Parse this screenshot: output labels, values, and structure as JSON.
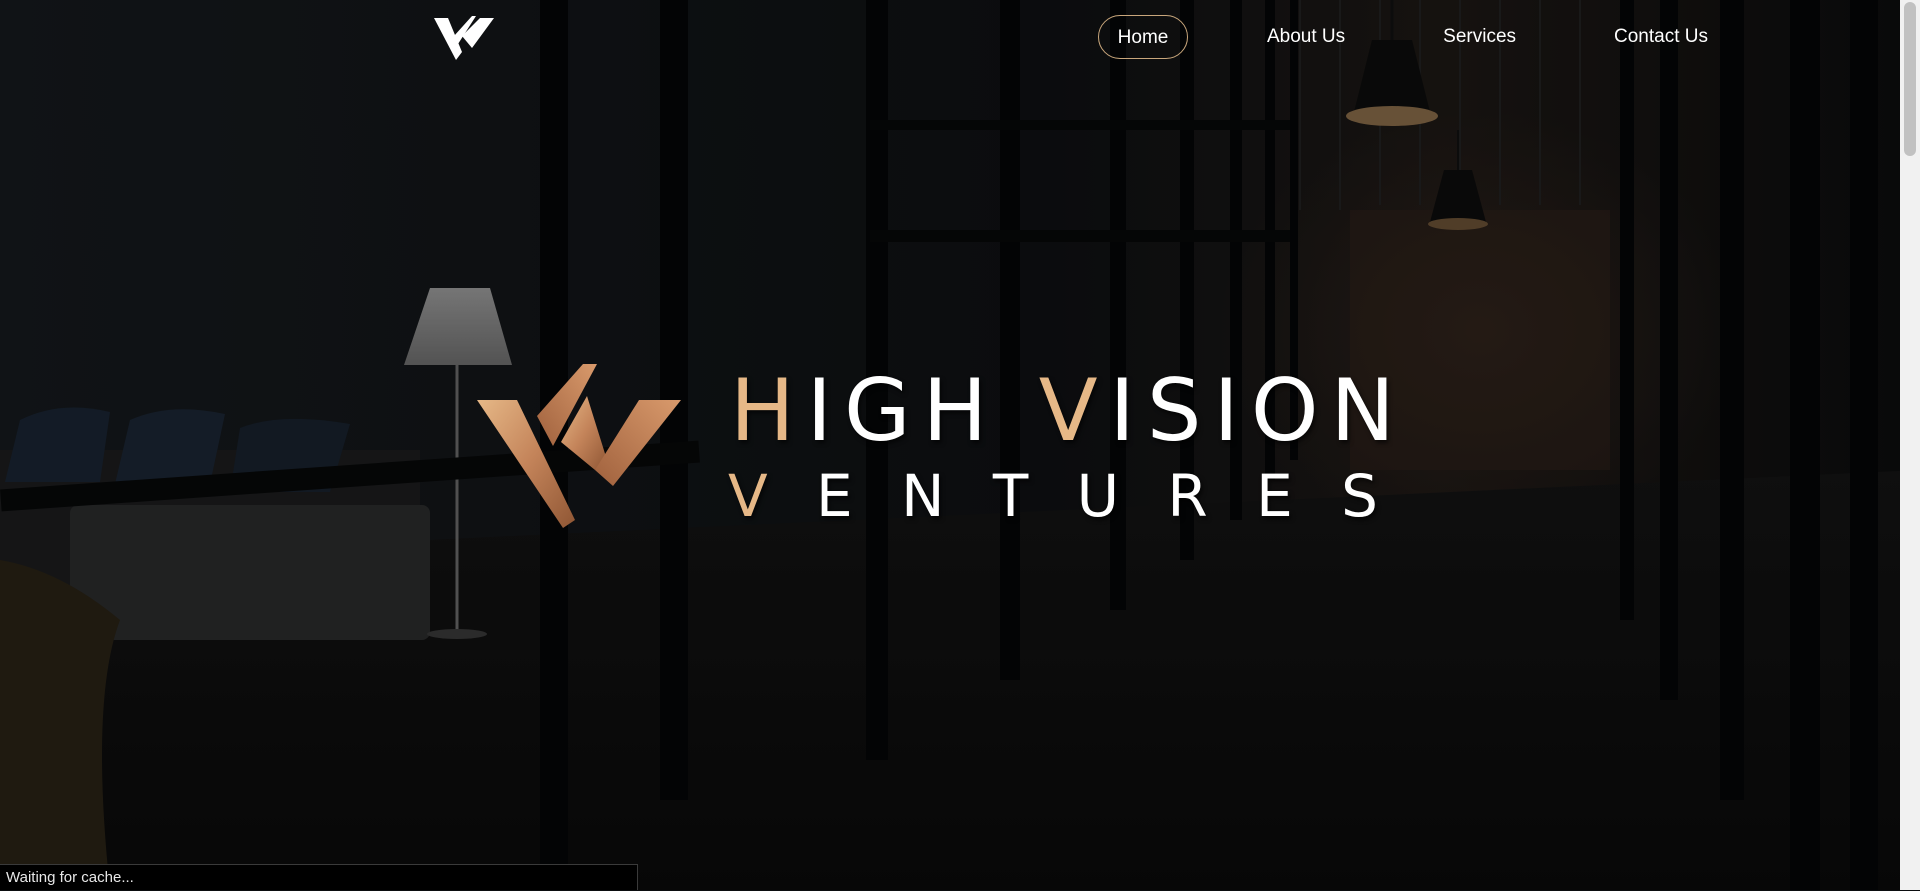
{
  "nav": {
    "items": [
      {
        "label": "Home",
        "active": true
      },
      {
        "label": "About Us"
      },
      {
        "label": "Services"
      },
      {
        "label": "Contact Us"
      }
    ]
  },
  "hero": {
    "title_first_initial": "H",
    "title_first_rest": "IGH ",
    "title_second_initial": "V",
    "title_second_rest": "ISION",
    "subtitle_letters": [
      "V",
      "E",
      "N",
      "T",
      "U",
      "R",
      "E",
      "S"
    ]
  },
  "status_bar": {
    "text": "Waiting for cache..."
  },
  "colors": {
    "accent": "#e6b887",
    "copper_dark": "#b8734a",
    "nav_active_border": "#c9a77c",
    "text": "#ffffff"
  },
  "icons": {
    "nav_logo": "hv-monogram-icon",
    "hero_logo": "hv-monogram-copper-icon"
  }
}
